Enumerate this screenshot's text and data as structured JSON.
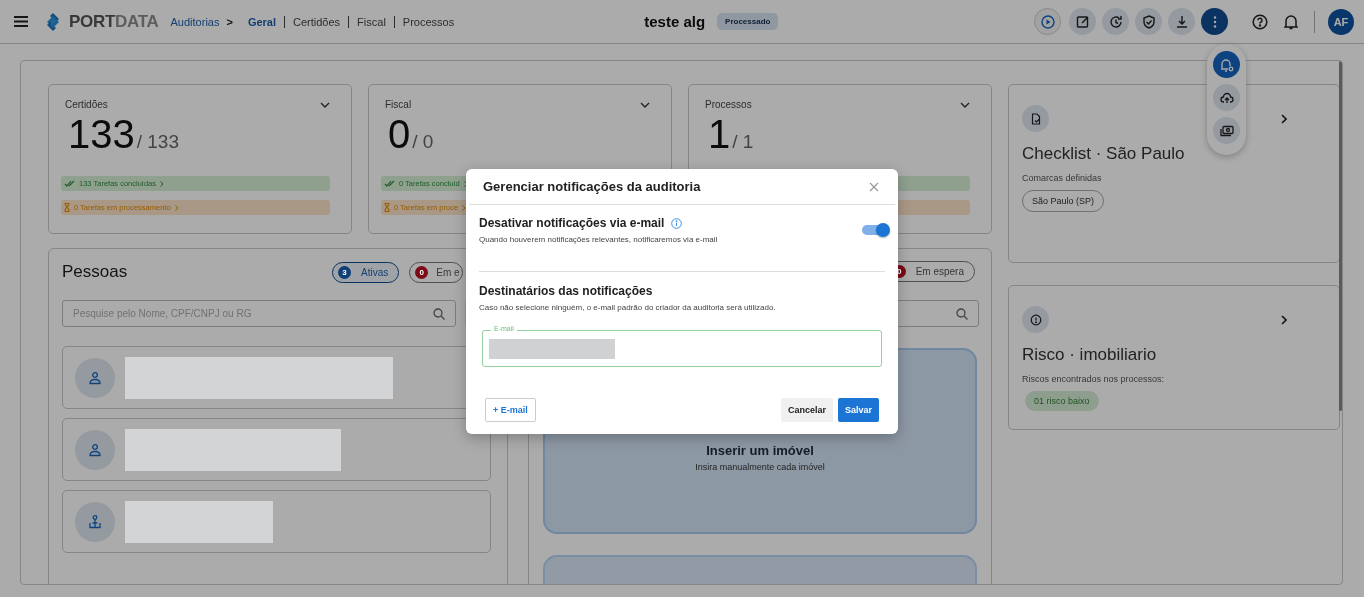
{
  "header": {
    "brand_first": "PORT",
    "brand_second": "DATA",
    "root": "Auditorias",
    "separator": ">",
    "tabs": [
      {
        "label": "Geral",
        "selected": true
      },
      {
        "label": "Certidões",
        "selected": false
      },
      {
        "label": "Fiscal",
        "selected": false
      },
      {
        "label": "Processos",
        "selected": false
      }
    ],
    "title": "teste alg",
    "status": "Processado",
    "actions": [
      {
        "kind": "play",
        "selected": false
      },
      {
        "kind": "edit",
        "selected": false
      },
      {
        "kind": "history",
        "selected": false
      },
      {
        "kind": "shield",
        "selected": false
      },
      {
        "kind": "download",
        "selected": false
      },
      {
        "kind": "more",
        "selected": true
      }
    ],
    "avatar": "AF"
  },
  "menu": [
    {
      "kind": "bell-settings",
      "selected": true
    },
    {
      "kind": "cloud-upload",
      "selected": false
    },
    {
      "kind": "money",
      "selected": false
    }
  ],
  "summary_cards": [
    {
      "title": "Certidões",
      "value": "133",
      "total": "/ 133",
      "tasks": [
        {
          "kind": "done",
          "label": "133 Tarefas concluídas"
        },
        {
          "kind": "processing",
          "label": "0 Tarefas em processamento"
        }
      ]
    },
    {
      "title": "Fiscal",
      "value": "0",
      "total": "/ 0",
      "tasks": [
        {
          "kind": "done",
          "label": "0 Tarefas concluíd"
        },
        {
          "kind": "processing",
          "label": "0 Tarefas em proce"
        }
      ]
    },
    {
      "title": "Processos",
      "value": "1",
      "total": "/ 1",
      "tasks": [
        {
          "kind": "done"
        },
        {
          "kind": "processing"
        }
      ]
    }
  ],
  "people": {
    "title": "Pessoas",
    "chips": [
      {
        "count": "3",
        "label": "Ativas",
        "selected": true,
        "color": "#0f3f77"
      },
      {
        "count": "0",
        "label": "Em e",
        "selected": false,
        "color": "#7a0a15"
      }
    ],
    "search": {
      "placeholder": "Pesquise pelo Nome, CPF/CNPJ ou RG"
    },
    "rows": [
      {
        "kind": "person"
      },
      {
        "kind": "person"
      },
      {
        "kind": "company"
      }
    ]
  },
  "properties": {
    "chips": [
      {
        "count": "0",
        "label": "Em espera",
        "selected": false,
        "color": "#7a0a15"
      }
    ],
    "cards": [
      {
        "kind": "manual",
        "title": "Inserir um imóvel",
        "subtitle": "Insira manualmente cada imóvel"
      },
      {
        "kind": "other"
      }
    ]
  },
  "side_cards": [
    {
      "kind": "checklist",
      "title": "Checklist · São Paulo",
      "subtitle": "Comarcas definidas",
      "tags": [
        {
          "label": "São Paulo (SP)",
          "kind": "neutral"
        }
      ]
    },
    {
      "kind": "risk",
      "title": "Risco · imobiliario",
      "subtitle": "Riscos encontrados nos processos:",
      "tags": [
        {
          "label": "01 risco baixo",
          "kind": "low"
        }
      ]
    }
  ],
  "dialog": {
    "title": "Gerenciar notificações da auditoria",
    "toggle": {
      "label": "Desativar notificações via e-mail",
      "hint": "Quando houverem notificações relevantes, notificaremos via e-mail",
      "on": true
    },
    "recipients": {
      "title": "Destinatários das notificações",
      "hint": "Caso não selecione ninguém, o e-mail padrão do criador da auditoria será utilizado."
    },
    "field": {
      "label": "E-mail"
    },
    "buttons": [
      {
        "kind": "add",
        "label": "+ E-mail"
      },
      {
        "kind": "cancel",
        "label": "Cancelar"
      },
      {
        "kind": "save",
        "label": "Salvar"
      }
    ]
  }
}
